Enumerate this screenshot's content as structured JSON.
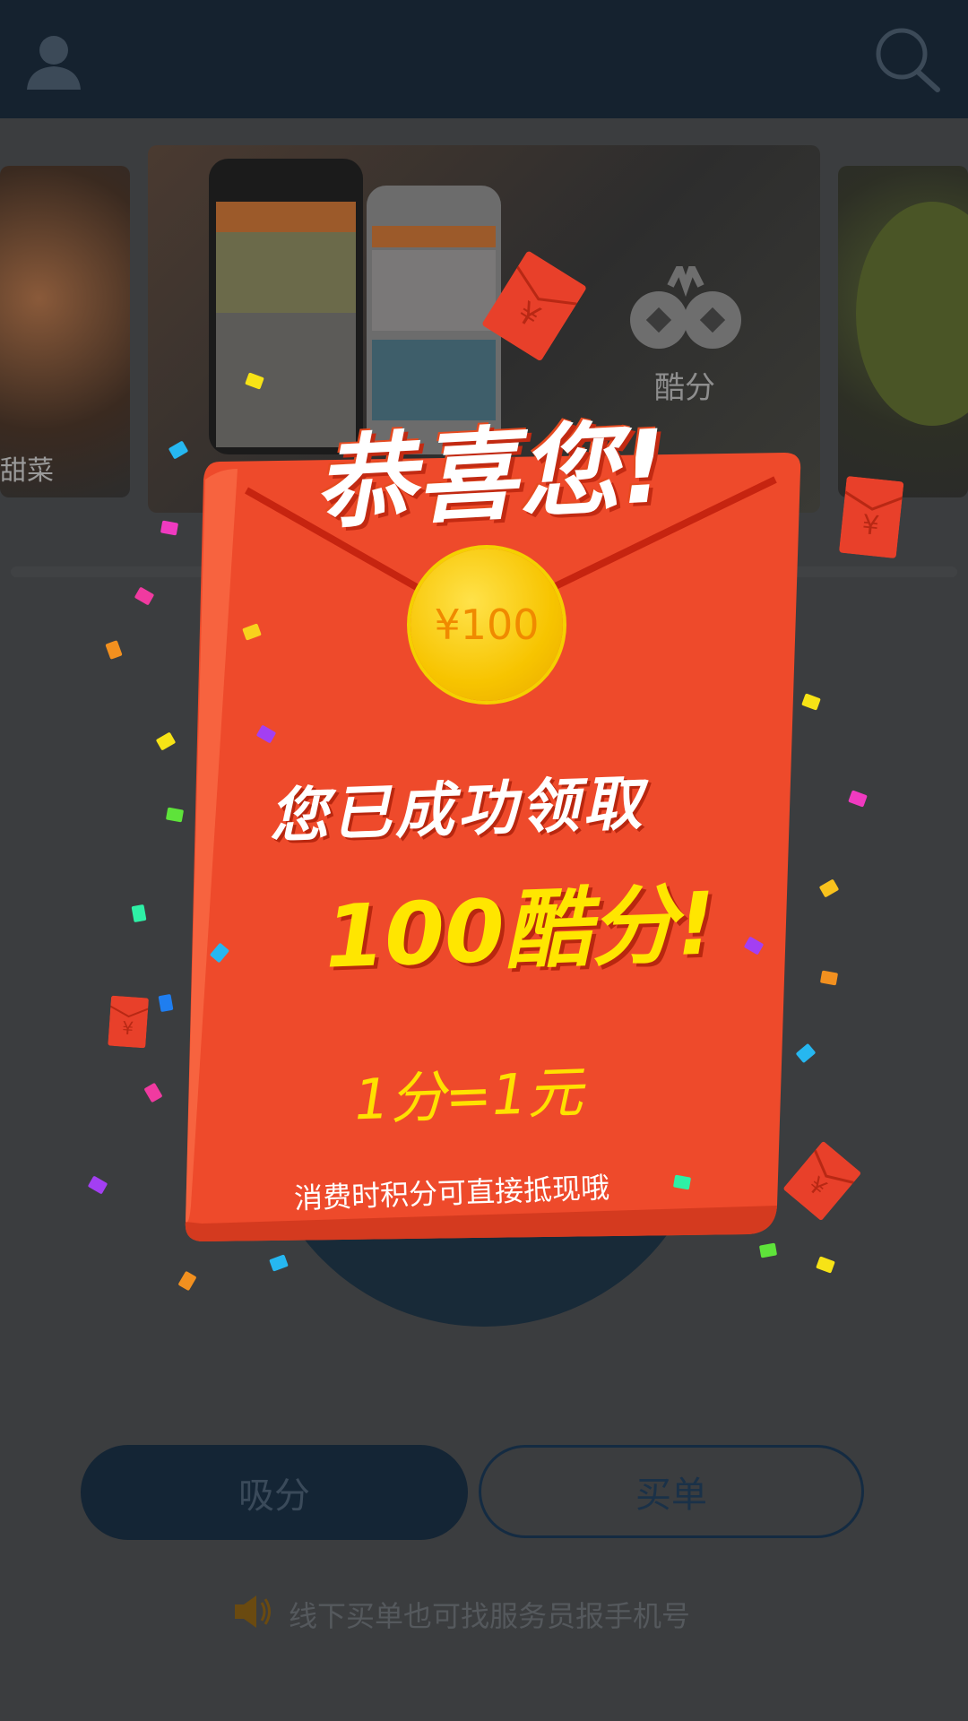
{
  "header": {
    "profile_icon": "user-icon",
    "search_icon": "search-icon"
  },
  "carousel": {
    "left_card_label": "甜菜",
    "center_brand_label": "酷分"
  },
  "actions": {
    "xifen_label": "吸分",
    "maidan_label": "买单"
  },
  "tip": {
    "icon": "speaker-icon",
    "text": "线下买单也可找服务员报手机号"
  },
  "packet": {
    "title": "恭喜您!",
    "coin_label": "¥100",
    "message_line1": "您已成功领取",
    "message_line2": "100酷分!",
    "rate": "1分=1元",
    "note": "消费时积分可直接抵现哦",
    "mini_envelope_symbol": "¥"
  },
  "colors": {
    "header_bg": "#15222f",
    "packet_red": "#ee4a2b",
    "coin_gold": "#f7c400",
    "highlight_yellow": "#ffe600"
  }
}
